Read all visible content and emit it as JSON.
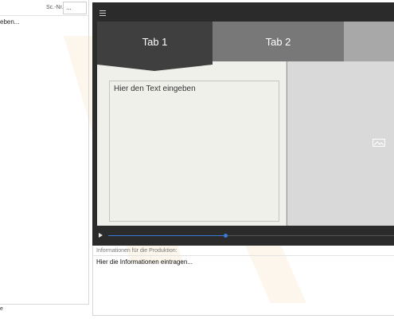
{
  "left": {
    "sc_label": "Sc.-Nr.:",
    "sc_value": "...",
    "text_fragment": "eben...",
    "bottom_fragment": "e"
  },
  "player": {
    "tabs": [
      {
        "label": "Tab 1"
      },
      {
        "label": "Tab 2"
      },
      {
        "label": ""
      }
    ],
    "textbox_text": "Hier den Text eingeben",
    "progress_fraction": 0.41
  },
  "info": {
    "label": "Informationen für die Produktion:",
    "text": "Hier die Informationen eintragen..."
  },
  "colors": {
    "player_bg": "#2b2b2b",
    "tab_active": "#3f3f3f",
    "tab_inactive": "#787878",
    "progress": "#3a7bd5"
  }
}
